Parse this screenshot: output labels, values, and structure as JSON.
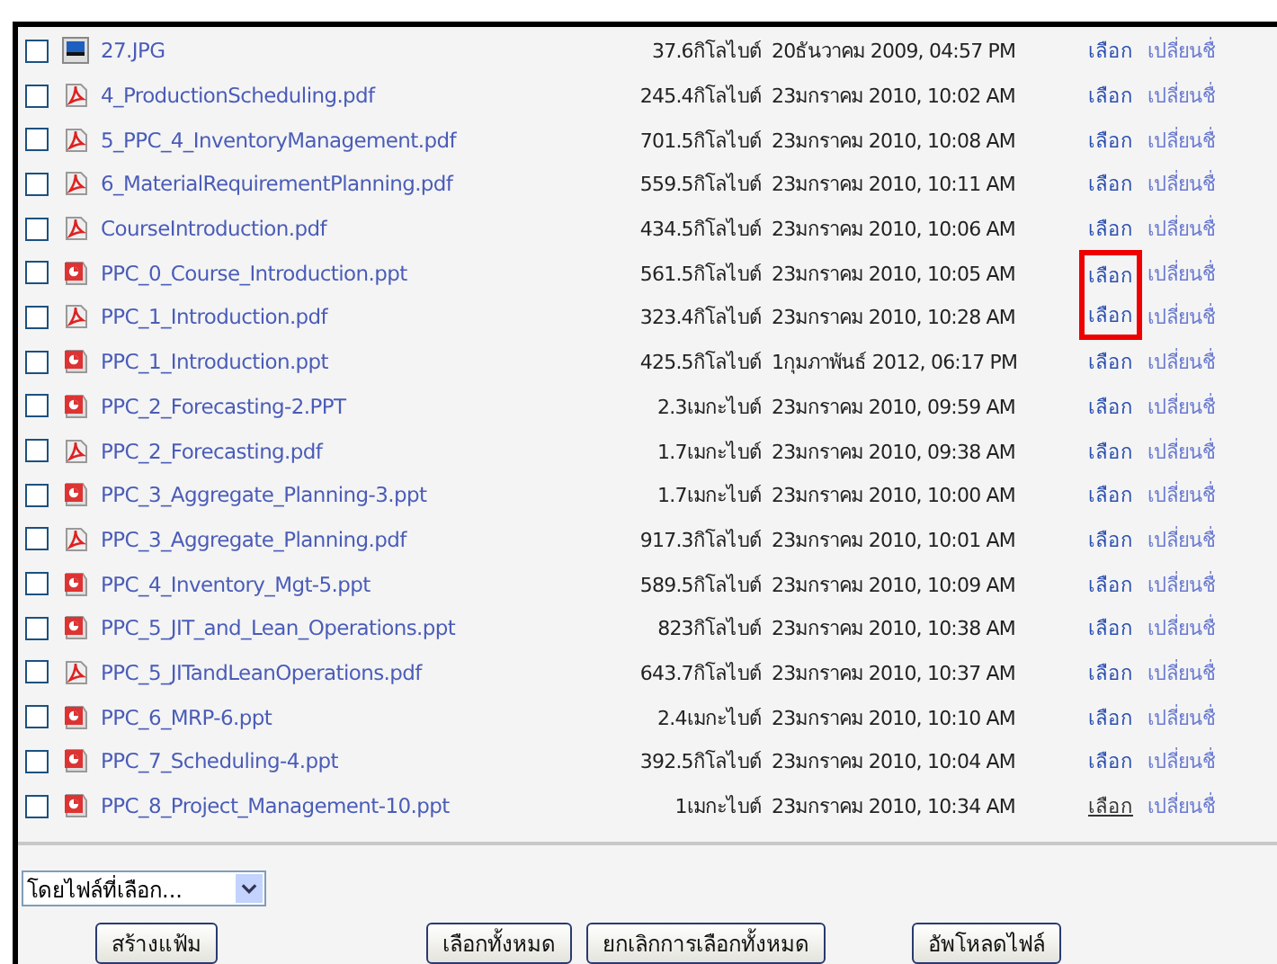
{
  "files": [
    {
      "name": "27.JPG",
      "kind": "image",
      "size": "37.6กิโลไบต์",
      "modified": "20ธันวาคม 2009, 04:57 PM",
      "choose": "เลือก",
      "rename": "เปลี่ยนชื่",
      "checked": false,
      "highlighted": false,
      "hovered": false
    },
    {
      "name": "4_ProductionScheduling.pdf",
      "kind": "pdf",
      "size": "245.4กิโลไบต์",
      "modified": "23มกราคม 2010, 10:02 AM",
      "choose": "เลือก",
      "rename": "เปลี่ยนชื่",
      "checked": false,
      "highlighted": false,
      "hovered": false
    },
    {
      "name": "5_PPC_4_InventoryManagement.pdf",
      "kind": "pdf",
      "size": "701.5กิโลไบต์",
      "modified": "23มกราคม 2010, 10:08 AM",
      "choose": "เลือก",
      "rename": "เปลี่ยนชื่",
      "checked": false,
      "highlighted": false,
      "hovered": false
    },
    {
      "name": "6_MaterialRequirementPlanning.pdf",
      "kind": "pdf",
      "size": "559.5กิโลไบต์",
      "modified": "23มกราคม 2010, 10:11 AM",
      "choose": "เลือก",
      "rename": "เปลี่ยนชื่",
      "checked": false,
      "highlighted": false,
      "hovered": false
    },
    {
      "name": "CourseIntroduction.pdf",
      "kind": "pdf",
      "size": "434.5กิโลไบต์",
      "modified": "23มกราคม 2010, 10:06 AM",
      "choose": "เลือก",
      "rename": "เปลี่ยนชื่",
      "checked": false,
      "highlighted": false,
      "hovered": false
    },
    {
      "name": "PPC_0_Course_Introduction.ppt",
      "kind": "ppt",
      "size": "561.5กิโลไบต์",
      "modified": "23มกราคม 2010, 10:05 AM",
      "choose": "เลือก",
      "rename": "เปลี่ยนชื่",
      "checked": false,
      "highlighted": true,
      "hovered": false
    },
    {
      "name": "PPC_1_Introduction.pdf",
      "kind": "pdf",
      "size": "323.4กิโลไบต์",
      "modified": "23มกราคม 2010, 10:28 AM",
      "choose": "เลือก",
      "rename": "เปลี่ยนชื่",
      "checked": false,
      "highlighted": true,
      "hovered": false
    },
    {
      "name": "PPC_1_Introduction.ppt",
      "kind": "ppt",
      "size": "425.5กิโลไบต์",
      "modified": "1กุมภาพันธ์ 2012, 06:17 PM",
      "choose": "เลือก",
      "rename": "เปลี่ยนชื่",
      "checked": false,
      "highlighted": false,
      "hovered": false
    },
    {
      "name": "PPC_2_Forecasting-2.PPT",
      "kind": "ppt",
      "size": "2.3เมกะไบต์",
      "modified": "23มกราคม 2010, 09:59 AM",
      "choose": "เลือก",
      "rename": "เปลี่ยนชื่",
      "checked": false,
      "highlighted": false,
      "hovered": false
    },
    {
      "name": "PPC_2_Forecasting.pdf",
      "kind": "pdf",
      "size": "1.7เมกะไบต์",
      "modified": "23มกราคม 2010, 09:38 AM",
      "choose": "เลือก",
      "rename": "เปลี่ยนชื่",
      "checked": false,
      "highlighted": false,
      "hovered": false
    },
    {
      "name": "PPC_3_Aggregate_Planning-3.ppt",
      "kind": "ppt",
      "size": "1.7เมกะไบต์",
      "modified": "23มกราคม 2010, 10:00 AM",
      "choose": "เลือก",
      "rename": "เปลี่ยนชื่",
      "checked": false,
      "highlighted": false,
      "hovered": false
    },
    {
      "name": "PPC_3_Aggregate_Planning.pdf",
      "kind": "pdf",
      "size": "917.3กิโลไบต์",
      "modified": "23มกราคม 2010, 10:01 AM",
      "choose": "เลือก",
      "rename": "เปลี่ยนชื่",
      "checked": false,
      "highlighted": false,
      "hovered": false
    },
    {
      "name": "PPC_4_Inventory_Mgt-5.ppt",
      "kind": "ppt",
      "size": "589.5กิโลไบต์",
      "modified": "23มกราคม 2010, 10:09 AM",
      "choose": "เลือก",
      "rename": "เปลี่ยนชื่",
      "checked": false,
      "highlighted": false,
      "hovered": false
    },
    {
      "name": "PPC_5_JIT_and_Lean_Operations.ppt",
      "kind": "ppt",
      "size": "823กิโลไบต์",
      "modified": "23มกราคม 2010, 10:38 AM",
      "choose": "เลือก",
      "rename": "เปลี่ยนชื่",
      "checked": false,
      "highlighted": false,
      "hovered": false
    },
    {
      "name": "PPC_5_JITandLeanOperations.pdf",
      "kind": "pdf",
      "size": "643.7กิโลไบต์",
      "modified": "23มกราคม 2010, 10:37 AM",
      "choose": "เลือก",
      "rename": "เปลี่ยนชื่",
      "checked": false,
      "highlighted": false,
      "hovered": false
    },
    {
      "name": "PPC_6_MRP-6.ppt",
      "kind": "ppt",
      "size": "2.4เมกะไบต์",
      "modified": "23มกราคม 2010, 10:10 AM",
      "choose": "เลือก",
      "rename": "เปลี่ยนชื่",
      "checked": false,
      "highlighted": false,
      "hovered": false
    },
    {
      "name": "PPC_7_Scheduling-4.ppt",
      "kind": "ppt",
      "size": "392.5กิโลไบต์",
      "modified": "23มกราคม 2010, 10:04 AM",
      "choose": "เลือก",
      "rename": "เปลี่ยนชื่",
      "checked": false,
      "highlighted": false,
      "hovered": false
    },
    {
      "name": "PPC_8_Project_Management-10.ppt",
      "kind": "ppt",
      "size": "1เมกะไบต์",
      "modified": "23มกราคม 2010, 10:34 AM",
      "choose": "เลือก",
      "rename": "เปลี่ยนชื่",
      "checked": false,
      "highlighted": false,
      "hovered": true
    }
  ],
  "action_select": {
    "value": "โดยไฟล์ที่เลือก..."
  },
  "buttons": [
    {
      "label": "สร้างแฟ้ม",
      "kind": "create"
    },
    {
      "label": "เลือกทั้งหมด",
      "kind": "select-all"
    },
    {
      "label": "ยกเลิกการเลือกทั้งหมด",
      "kind": "deselect-all"
    },
    {
      "label": "อัพโหลดไฟล์",
      "kind": "upload"
    }
  ]
}
